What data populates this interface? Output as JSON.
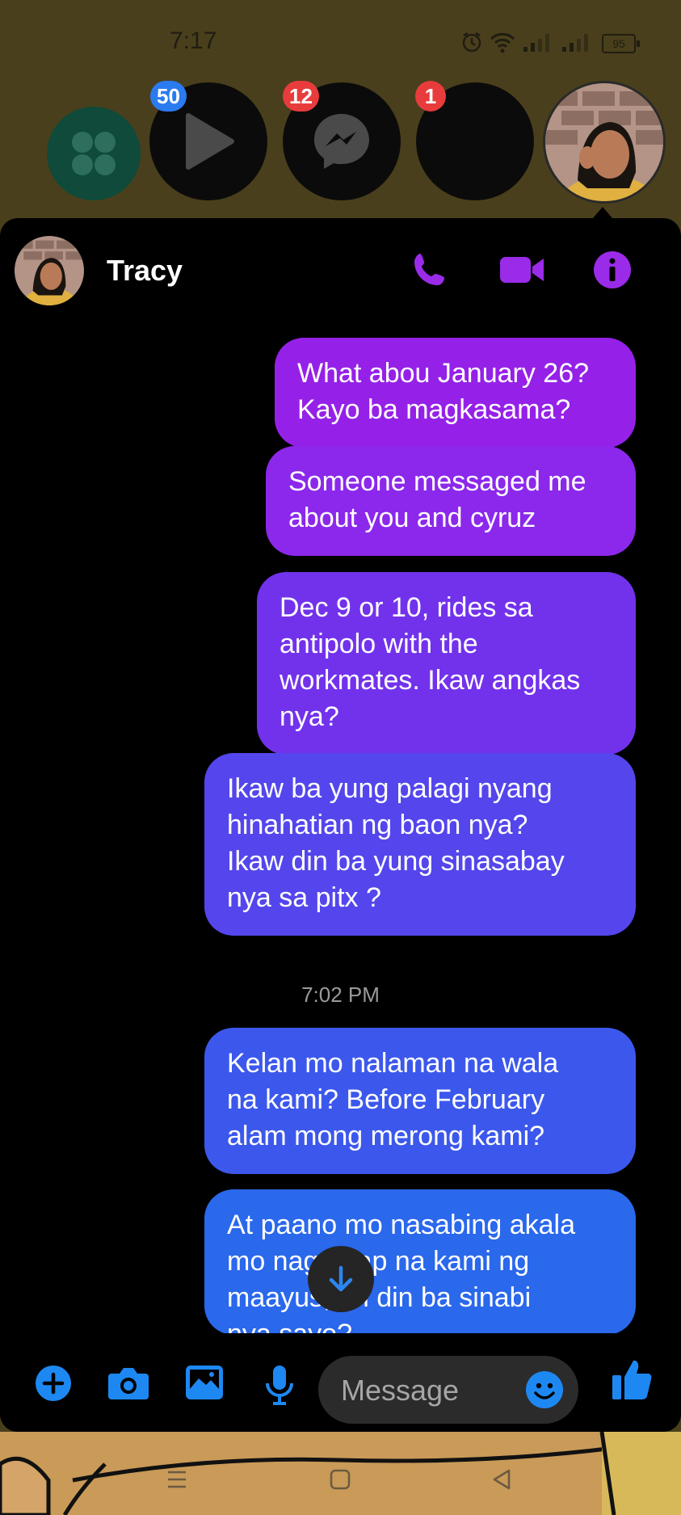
{
  "status_bar": {
    "time": "7:17",
    "battery": "95"
  },
  "chat_heads": [
    {
      "app": "apps-grid"
    },
    {
      "app": "play",
      "badge": "50"
    },
    {
      "app": "messenger",
      "badge": "12"
    },
    {
      "app": "blank",
      "badge": "1"
    },
    {
      "app": "tracy-avatar"
    }
  ],
  "header": {
    "contact_name": "Tracy"
  },
  "messages": [
    {
      "text": "What abou January 26?\nKayo ba magkasama?"
    },
    {
      "text": "Someone messaged me\nabout you and cyruz"
    },
    {
      "text": "Dec 9 or 10, rides sa\nantipolo with the\nworkmates. Ikaw angkas\nnya?"
    },
    {
      "text": "Ikaw ba yung palagi nyang\nhinahatian ng baon nya?\nIkaw din ba yung sinasabay\nnya sa pitx ?"
    },
    {
      "text": "Kelan mo nalaman na wala\nna kami? Before February\nalam mong merong kami?"
    },
    {
      "text": "At paano mo nasabing akala\nmo nag-usap na kami ng\nmaayus, un din ba sinabi\nnya sayo?"
    }
  ],
  "timestamp": "7:02 PM",
  "composer": {
    "placeholder": "Message"
  },
  "colors": {
    "accent": "#8a2be2",
    "bubble_gradient_top": "#9521e8",
    "bubble_gradient_bottom": "#2a68ec",
    "icon_blue": "#1e88f2"
  }
}
